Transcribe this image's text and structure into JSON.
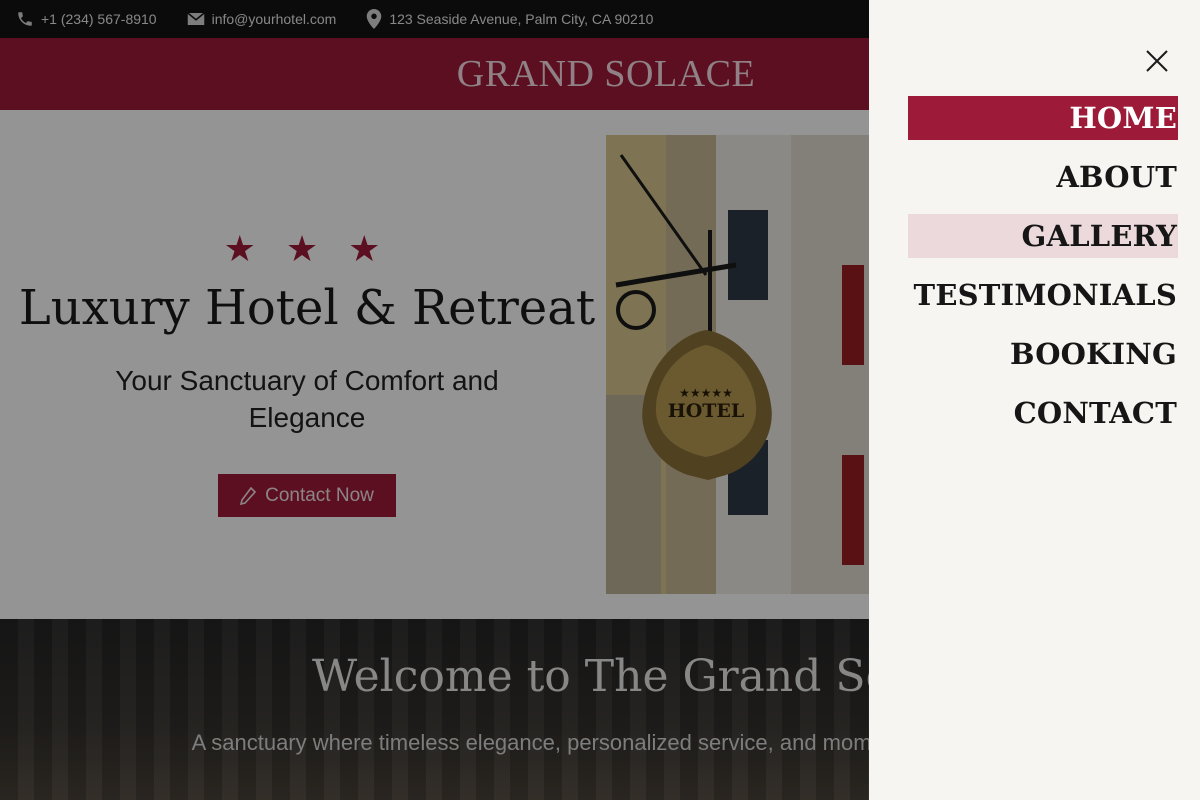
{
  "topbar": {
    "phone": "+1 (234) 567-8910",
    "email": "info@yourhotel.com",
    "address": "123 Seaside Avenue, Palm City, CA 90210"
  },
  "header": {
    "brand": "GRAND SOLACE"
  },
  "hero": {
    "stars": "★ ★ ★",
    "title": "Luxury Hotel & Retreat",
    "subtitle": "Your Sanctuary of Comfort and Elegance",
    "button_label": "Contact Now",
    "sign_text": "HOTEL"
  },
  "welcome": {
    "title": "Welcome to The Grand Solac",
    "text": "A sanctuary where timeless elegance, personalized service, and moments await you."
  },
  "menu": {
    "items": [
      {
        "label": "HOME",
        "state": "active"
      },
      {
        "label": "ABOUT",
        "state": "normal"
      },
      {
        "label": "GALLERY",
        "state": "hover"
      },
      {
        "label": "TESTIMONIALS",
        "state": "normal"
      },
      {
        "label": "BOOKING",
        "state": "normal"
      },
      {
        "label": "CONTACT",
        "state": "normal"
      }
    ]
  },
  "colors": {
    "accent": "#9d1b38",
    "menu_bg": "#f7f5f1",
    "hover_bg": "#ecd9dc"
  },
  "icons": [
    "phone-icon",
    "mail-icon",
    "location-icon",
    "pencil-icon",
    "close-icon"
  ]
}
